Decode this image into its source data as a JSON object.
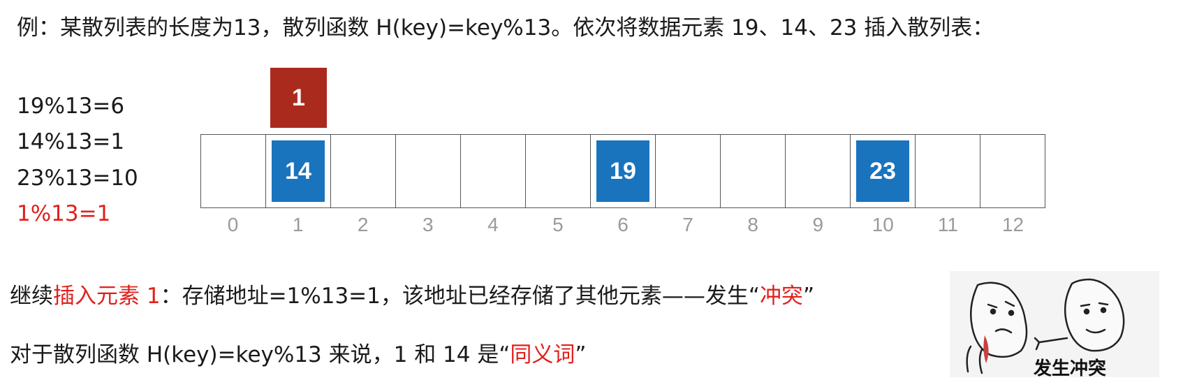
{
  "title": "例：某散列表的长度为13，散列函数 H(key)=key%13。依次将数据元素 19、14、23 插入散列表：",
  "calculations": [
    {
      "text": "19%13=6",
      "color": "#1a1a1a"
    },
    {
      "text": "14%13=1",
      "color": "#1a1a1a"
    },
    {
      "text": "23%13=10",
      "color": "#1a1a1a"
    },
    {
      "text": "1%13=1",
      "color": "#e0201c"
    }
  ],
  "table": {
    "indices": [
      "0",
      "1",
      "2",
      "3",
      "4",
      "5",
      "6",
      "7",
      "8",
      "9",
      "10",
      "11",
      "12"
    ],
    "cells": [
      "",
      "14",
      "",
      "",
      "",
      "",
      "19",
      "",
      "",
      "",
      "23",
      "",
      ""
    ],
    "fill_color": "#1a74bd"
  },
  "conflict_element": {
    "value": "1",
    "slot": 1,
    "color": "#aa2a1e"
  },
  "paragraph1": {
    "part1": "继续",
    "part2": "插入元素 1",
    "part3": "：存储地址=1%13=1，该地址已经存储了其他元素——发生“",
    "part4": "冲突",
    "part5": "”"
  },
  "paragraph2": {
    "part1": "对于散列函数 H(key)=key%13 来说，1 和 14 是“",
    "part2": "同义词",
    "part3": "”"
  },
  "meme": {
    "caption": "发生冲突"
  }
}
